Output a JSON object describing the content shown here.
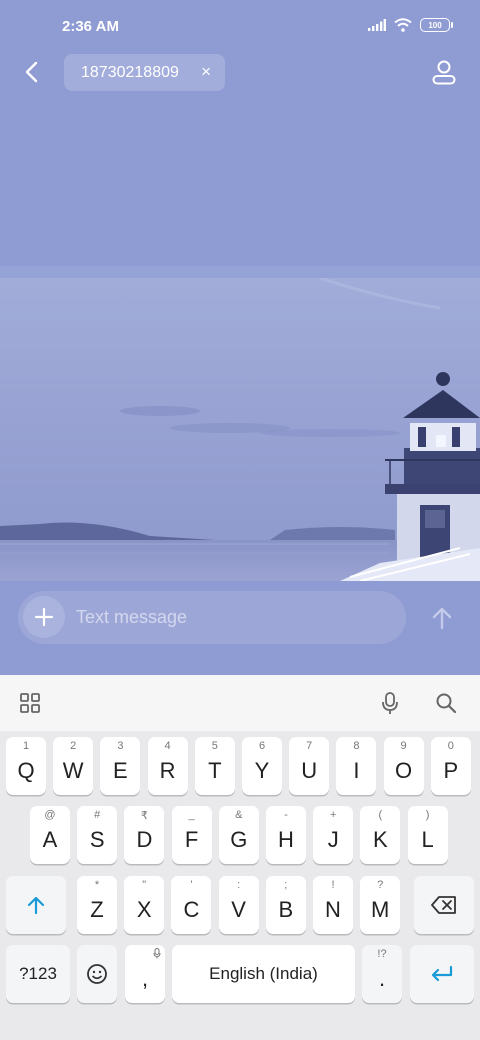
{
  "status_bar": {
    "time": "2:36 AM",
    "battery": "100",
    "icons": [
      "signal-icon",
      "wifi-icon",
      "battery-icon"
    ]
  },
  "header": {
    "recipient": "18730218809",
    "chip_close": "×",
    "icons": [
      "back-arrow-icon",
      "contact-person-icon"
    ]
  },
  "composer": {
    "placeholder": "Text message",
    "add_icon": "plus-icon",
    "send_icon": "send-arrow-up-icon"
  },
  "keyboard": {
    "toolbar_icons": [
      "grid-apps-icon",
      "microphone-icon",
      "search-icon"
    ],
    "row1": [
      {
        "hint": "1",
        "label": "Q"
      },
      {
        "hint": "2",
        "label": "W"
      },
      {
        "hint": "3",
        "label": "E"
      },
      {
        "hint": "4",
        "label": "R"
      },
      {
        "hint": "5",
        "label": "T"
      },
      {
        "hint": "6",
        "label": "Y"
      },
      {
        "hint": "7",
        "label": "U"
      },
      {
        "hint": "8",
        "label": "I"
      },
      {
        "hint": "9",
        "label": "O"
      },
      {
        "hint": "0",
        "label": "P"
      }
    ],
    "row2": [
      {
        "hint": "@",
        "label": "A"
      },
      {
        "hint": "#",
        "label": "S"
      },
      {
        "hint": "₹",
        "label": "D"
      },
      {
        "hint": "_",
        "label": "F"
      },
      {
        "hint": "&",
        "label": "G"
      },
      {
        "hint": "-",
        "label": "H"
      },
      {
        "hint": "+",
        "label": "J"
      },
      {
        "hint": "(",
        "label": "K"
      },
      {
        "hint": ")",
        "label": "L"
      }
    ],
    "row3": [
      {
        "hint": "*",
        "label": "Z"
      },
      {
        "hint": "\"",
        "label": "X"
      },
      {
        "hint": "'",
        "label": "C"
      },
      {
        "hint": ":",
        "label": "V"
      },
      {
        "hint": ";",
        "label": "B"
      },
      {
        "hint": "!",
        "label": "N"
      },
      {
        "hint": "?",
        "label": "M"
      }
    ],
    "symbols_label": "?123",
    "comma": ",",
    "space_label": "English (India)",
    "period": ".",
    "period_hint": "!?",
    "accent_color": "#1a9bd7"
  }
}
